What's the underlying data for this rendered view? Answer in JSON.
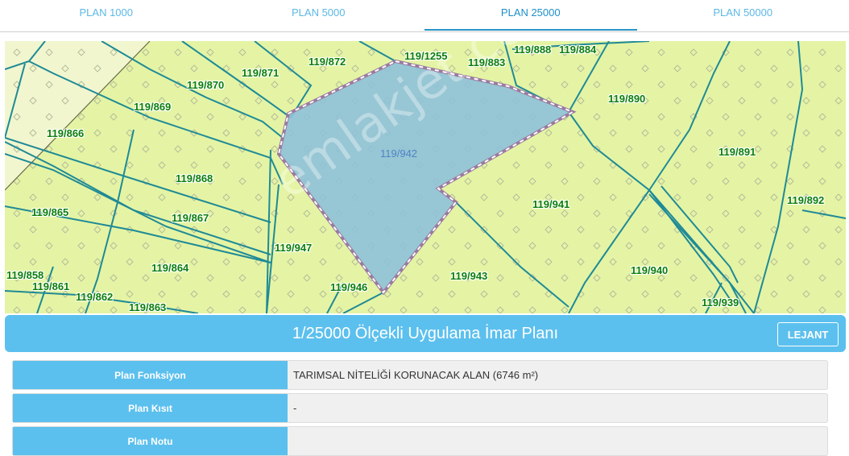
{
  "tabs": [
    {
      "label": "PLAN 1000",
      "active": false
    },
    {
      "label": "PLAN 5000",
      "active": false
    },
    {
      "label": "PLAN 25000",
      "active": true
    },
    {
      "label": "PLAN 50000",
      "active": false
    }
  ],
  "map": {
    "selected_parcel": "119/942",
    "parcels": [
      "119/872",
      "119/1255",
      "119/883",
      "119/888",
      "119/884",
      "119/870",
      "119/871",
      "119/869",
      "119/890",
      "119/866",
      "119/891",
      "119/868",
      "119/892",
      "119/865",
      "119/941",
      "119/867",
      "119/947",
      "119/864",
      "119/940",
      "119/858",
      "119/861",
      "119/946",
      "119/943",
      "119/862",
      "119/863",
      "119/939"
    ],
    "watermark": "emlakjet.com"
  },
  "title_bar": {
    "title": "1/25000 Ölçekli Uygulama İmar Planı",
    "legend_button": "LEJANT"
  },
  "info": [
    {
      "label": "Plan Fonksiyon",
      "value": "TARIMSAL NİTELİĞİ KORUNACAK ALAN (6746 m²)"
    },
    {
      "label": "Plan Kısıt",
      "value": "-"
    },
    {
      "label": "Plan Notu",
      "value": ""
    }
  ],
  "colors": {
    "accent": "#5cc0ee",
    "tab_text": "#5bb8e6",
    "map_fill": "#e4f4a4",
    "parcel_line": "#1f8a96",
    "selected_fill": "#8ec1d9",
    "selected_border": "#9a7aa0",
    "parcel_label": "#0b7e0b"
  }
}
